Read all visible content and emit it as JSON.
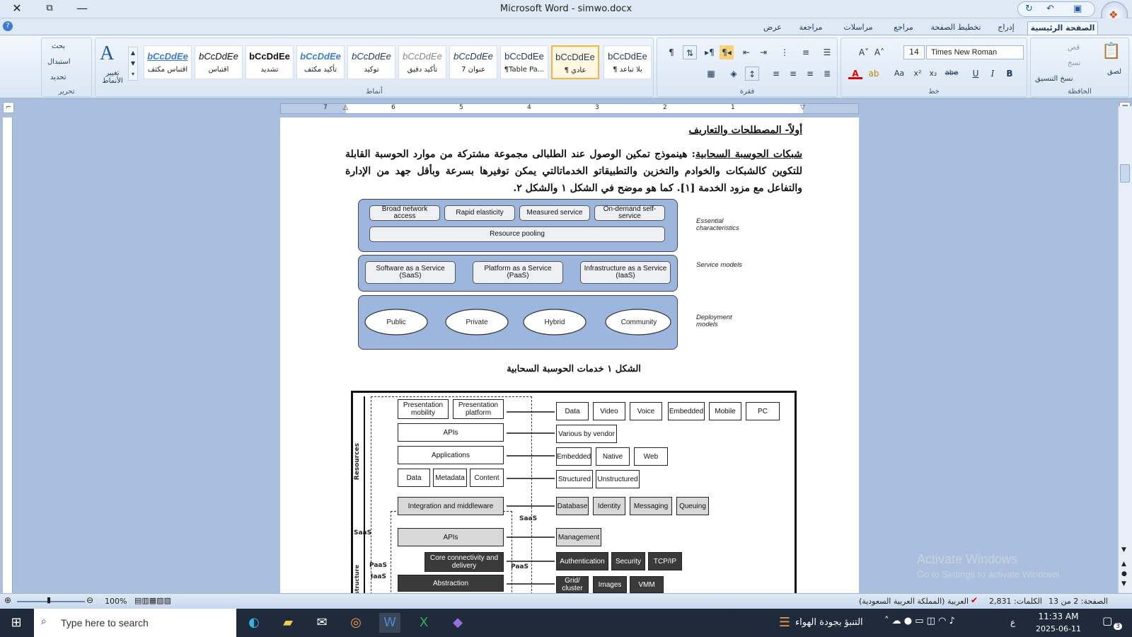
{
  "window": {
    "title": "Microsoft Word - simwo.docx",
    "close": "✕",
    "restore": "⧉",
    "minimize": "—"
  },
  "tabs": [
    "الصفحة الرئيسية",
    "إدراج",
    "تخطيط الصفحة",
    "مراجع",
    "مراسلات",
    "مراجعة",
    "عرض"
  ],
  "ribbon": {
    "clipboard": {
      "label": "الحافظة",
      "paste": "لصق",
      "cut": "قص",
      "copy": "نسخ",
      "format_painter": "نسخ التنسيق"
    },
    "font": {
      "label": "خط",
      "font_name": "Times New Roman",
      "font_size": "14"
    },
    "paragraph": {
      "label": "فقرة"
    },
    "styles": {
      "label": "أنماط",
      "change_styles": "تغيير الأنماط",
      "items": [
        {
          "preview": "bCcDdEe",
          "name": "¶ بلا تباعد"
        },
        {
          "preview": "bCcDdEe",
          "name": "¶ عادي"
        },
        {
          "preview": "bCcDdEe",
          "name": "¶Table Pa..."
        },
        {
          "preview": "bCcDdEe",
          "name": "عنوان 7"
        },
        {
          "preview": "bCcDdEe",
          "name": "تأكيد دقيق"
        },
        {
          "preview": "bCcDdEe",
          "name": "توكيد"
        },
        {
          "preview": "bCcDdEe",
          "name": "تأكيد مكثف"
        },
        {
          "preview": "bCcDdEe",
          "name": "تشديد"
        },
        {
          "preview": "bCcDdEe",
          "name": "اقتباس"
        },
        {
          "preview": "bCcDdEe",
          "name": "اقتباس مكثف"
        }
      ]
    },
    "editing": {
      "label": "تحرير",
      "find": "بحث",
      "replace": "استبدال",
      "select": "تحديد"
    }
  },
  "ruler": {
    "numbers": [
      "7",
      "6",
      "5",
      "4",
      "3",
      "2",
      "1"
    ]
  },
  "document": {
    "heading": "أولاً- المصطلحات والتعاريف",
    "paragraph_term": "شبكات الحوسبة السحابية",
    "paragraph_body": ": هينموذج تمكين الوصول عند الطلبالى مجموعة مشتركة من موارد الحوسبة القابلة للتكوين كالشبكات والخوادم والتخزين والتطبيقاتو الخدماتالتي يمكن توفيرها بسرعة  وبأقل جهد من الإدارة والتفاعل مع مزود الخدمة [١]. كما هو موضح في الشكل ١ والشكل ٢.",
    "figure1_caption": "الشكل ١ خدمات الحوسبة السحابية",
    "figure1": {
      "essential": [
        "Broad network access",
        "Rapid elasticity",
        "Measured service",
        "On-demand self-service"
      ],
      "pooling": "Resource pooling",
      "service": [
        "Software as a Service (SaaS)",
        "Platform as a Service (PaaS)",
        "Infrastructure as a Service (IaaS)"
      ],
      "deployment": [
        "Public",
        "Private",
        "Hybrid",
        "Community"
      ],
      "labels": [
        "Essential characteristics",
        "Service models",
        "Deployment models"
      ]
    },
    "figure2": {
      "left": [
        "Presentation mobility",
        "Presentation platform",
        "APIs",
        "Applications",
        "Data",
        "Metadata",
        "Content",
        "Integration and middleware",
        "APIs",
        "Core connectivity and delivery",
        "Abstraction"
      ],
      "right_row1": [
        "Data",
        "Video",
        "Voice",
        "Embedded",
        "Mobile",
        "PC"
      ],
      "right_row2": [
        "Various by vendor"
      ],
      "right_row3": [
        "Embedded",
        "Native",
        "Web"
      ],
      "right_row4": [
        "Structured",
        "Unstructured"
      ],
      "right_row5": [
        "Database",
        "Identity",
        "Messaging",
        "Queuing"
      ],
      "right_row6": [
        "Management"
      ],
      "right_row7": [
        "Authentication",
        "Security",
        "TCP/IP"
      ],
      "right_row8": [
        "Grid/ cluster",
        "Images",
        "VMM"
      ],
      "side": [
        "Resources",
        "SaaS",
        "PaaS",
        "IaaS",
        "Infrastructure"
      ],
      "mid": [
        "SaaS",
        "PaaS"
      ]
    }
  },
  "watermark": {
    "line1": "Activate Windows",
    "line2": "Go to Settings to activate Windows."
  },
  "status": {
    "page": "الصفحة: 2 من 13",
    "words": "الكلمات: 2,831",
    "language": "العربية (المملكة العربية السعودية)",
    "zoom": "100%"
  },
  "taskbar": {
    "search_placeholder": "Type here to search",
    "weather": "التنبؤ بجودة الهواء",
    "time": "11:33 AM",
    "date": "2025-06-11",
    "lang": "ع",
    "notif": "3"
  }
}
